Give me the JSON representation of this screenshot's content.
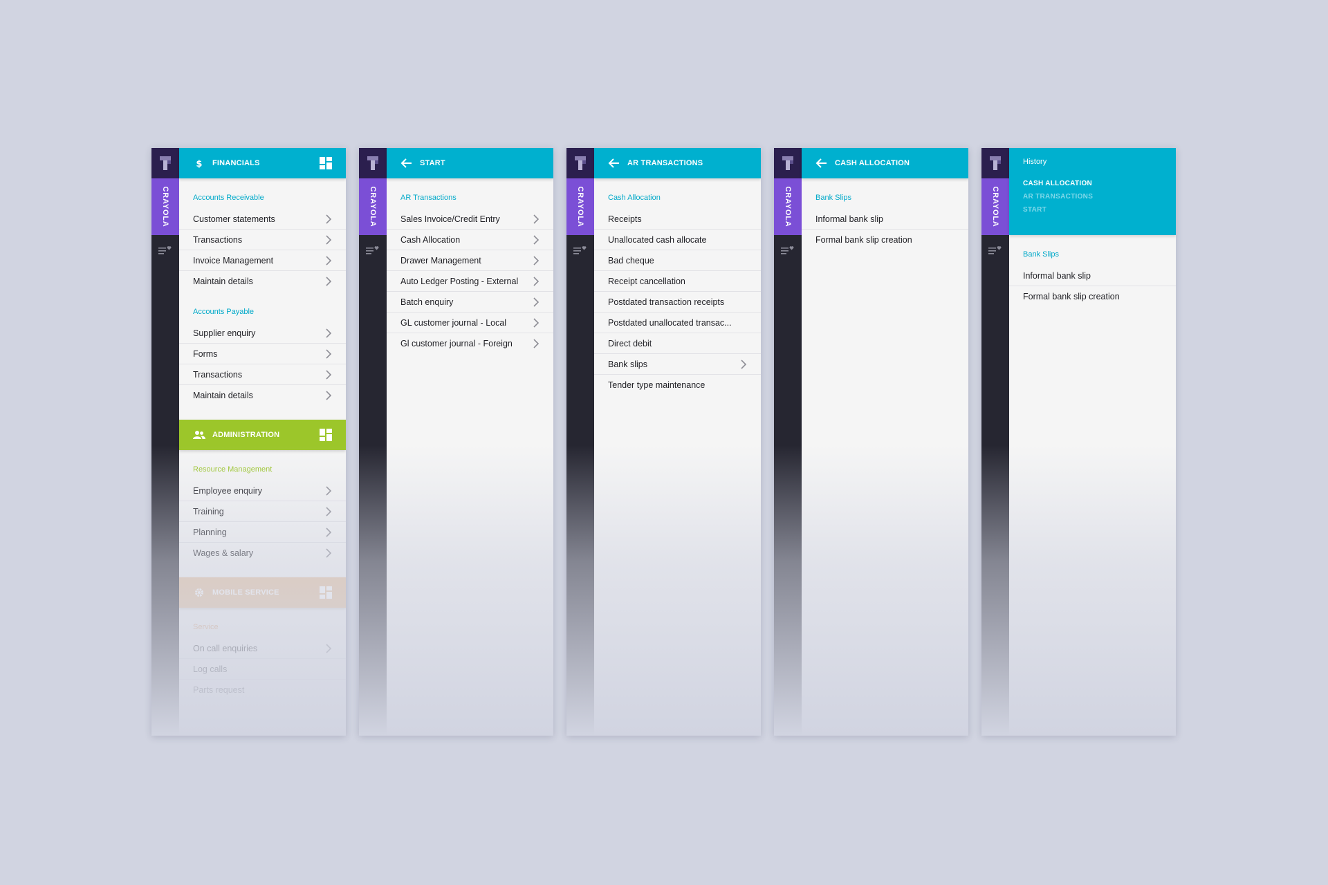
{
  "brand": {
    "name": "CRAYOLA"
  },
  "colors": {
    "cyan": "#00b0cf",
    "green": "#9cc62a",
    "peach": "#e7c29e",
    "purple": "#7b4fd6",
    "rail": "#262631"
  },
  "icons": {
    "logo": "logo-icon",
    "favorites": "favorites-list-icon",
    "dashboard": "dashboard-icon",
    "back": "arrow-left-icon",
    "chevron": "chevron-right-icon"
  },
  "panel1": {
    "financials": {
      "title": "FINANCIALS",
      "icon": "dollar-icon"
    },
    "accounts_receivable": {
      "label": "Accounts Receivable",
      "items": [
        "Customer statements",
        "Transactions",
        "Invoice Management",
        "Maintain details"
      ]
    },
    "accounts_payable": {
      "label": "Accounts Payable",
      "items": [
        "Supplier enquiry",
        "Forms",
        "Transactions",
        "Maintain details"
      ]
    },
    "administration": {
      "title": "ADMINISTRATION",
      "icon": "users-icon"
    },
    "resource_management": {
      "label": "Resource Management",
      "items": [
        "Employee enquiry",
        "Training",
        "Planning",
        "Wages & salary"
      ]
    },
    "mobile_service": {
      "title": "MOBILE SERVICE",
      "icon": "gear-icon"
    },
    "service": {
      "label": "Service",
      "items": [
        "On call enquiries",
        "Log calls",
        "Parts request"
      ]
    }
  },
  "panel2": {
    "header": "START",
    "section": "AR Transactions",
    "items": [
      "Sales Invoice/Credit Entry",
      "Cash Allocation",
      "Drawer Management",
      "Auto Ledger Posting - External",
      "Batch enquiry",
      "GL customer journal - Local",
      "Gl customer journal - Foreign"
    ]
  },
  "panel3": {
    "header": "AR TRANSACTIONS",
    "section": "Cash Allocation",
    "items": [
      "Receipts",
      "Unallocated cash allocate",
      "Bad cheque",
      "Receipt cancellation",
      "Postdated transaction receipts",
      "Postdated unallocated transac...",
      "Direct debit",
      "Bank slips",
      "Tender type maintenance"
    ]
  },
  "panel4": {
    "header": "CASH ALLOCATION",
    "section": "Bank Slips",
    "items": [
      "Informal bank slip",
      "Formal bank slip creation"
    ]
  },
  "panel5": {
    "history_title": "History",
    "history": [
      "CASH ALLOCATION",
      "AR TRANSACTIONS",
      "START"
    ],
    "section": "Bank Slips",
    "items": [
      "Informal bank slip",
      "Formal bank slip creation"
    ]
  }
}
